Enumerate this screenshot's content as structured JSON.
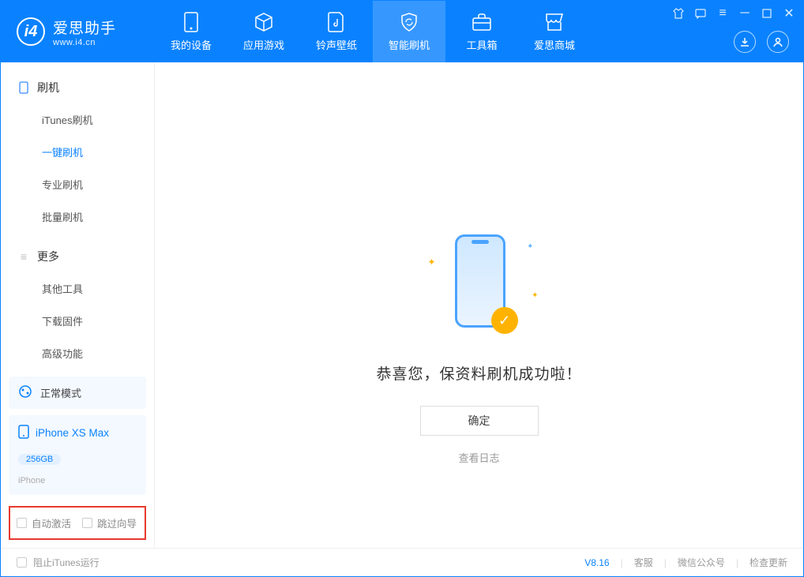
{
  "app": {
    "title": "爱思助手",
    "url": "www.i4.cn"
  },
  "tabs": [
    {
      "label": "我的设备"
    },
    {
      "label": "应用游戏"
    },
    {
      "label": "铃声壁纸"
    },
    {
      "label": "智能刷机"
    },
    {
      "label": "工具箱"
    },
    {
      "label": "爱思商城"
    }
  ],
  "sidebar": {
    "group1": "刷机",
    "items1": [
      "iTunes刷机",
      "一键刷机",
      "专业刷机",
      "批量刷机"
    ],
    "group2": "更多",
    "items2": [
      "其他工具",
      "下载固件",
      "高级功能"
    ]
  },
  "mode": {
    "label": "正常模式"
  },
  "device": {
    "name": "iPhone XS Max",
    "capacity": "256GB",
    "type": "iPhone"
  },
  "options": {
    "auto_activate": "自动激活",
    "skip_wizard": "跳过向导"
  },
  "main": {
    "success_title": "恭喜您，保资料刷机成功啦！",
    "ok": "确定",
    "view_log": "查看日志"
  },
  "footer": {
    "block_itunes": "阻止iTunes运行",
    "version": "V8.16",
    "support": "客服",
    "wechat": "微信公众号",
    "check_update": "检查更新"
  }
}
